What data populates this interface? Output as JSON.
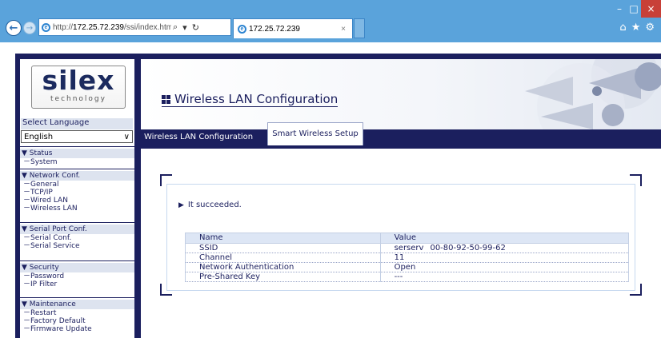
{
  "browser": {
    "address_prefix": "http://",
    "address_host": "172.25.72.239",
    "address_path": "/ssi/index.htm?pa",
    "tab_title": "172.25.72.239",
    "window_controls": [
      "–",
      "□",
      "×"
    ],
    "toolbar_icons": [
      "home-icon",
      "star-icon",
      "gear-icon"
    ]
  },
  "sidebar": {
    "logo_main": "silex",
    "logo_sub": "technology",
    "language_label": "Select Language",
    "language_value": "English",
    "groups": [
      {
        "head": "▼ Status",
        "items": [
          "－System"
        ]
      },
      {
        "head": "▼ Network Conf.",
        "items": [
          "－General",
          "－TCP/IP",
          "－Wired LAN",
          "－Wireless LAN"
        ]
      },
      {
        "head": "▼ Serial Port Conf.",
        "items": [
          "－Serial Conf.",
          "－Serial Service"
        ]
      },
      {
        "head": "▼ Security",
        "items": [
          "－Password",
          "－IP Filter"
        ]
      },
      {
        "head": "▼ Maintenance",
        "items": [
          "－Restart",
          "－Factory Default",
          "－Firmware Update"
        ]
      }
    ]
  },
  "header": {
    "title": "Wireless LAN Configuration"
  },
  "tabs": {
    "wlan_config": "Wireless LAN Configuration",
    "smart_setup": "Smart Wireless Setup"
  },
  "result": {
    "message": "It succeeded.",
    "table": {
      "headers": [
        "Name",
        "Value"
      ],
      "rows": [
        {
          "name": "SSID",
          "value": "serserv",
          "extra": "00-80-92-50-99-62"
        },
        {
          "name": "Channel",
          "value": "11",
          "extra": ""
        },
        {
          "name": "Network Authentication",
          "value": "Open",
          "extra": ""
        },
        {
          "name": "Pre-Shared Key",
          "value": "---",
          "extra": ""
        }
      ]
    }
  },
  "colors": {
    "navy": "#1b1f5e",
    "chrome_blue": "#5aa3db",
    "header_band": "#dde3ef"
  }
}
